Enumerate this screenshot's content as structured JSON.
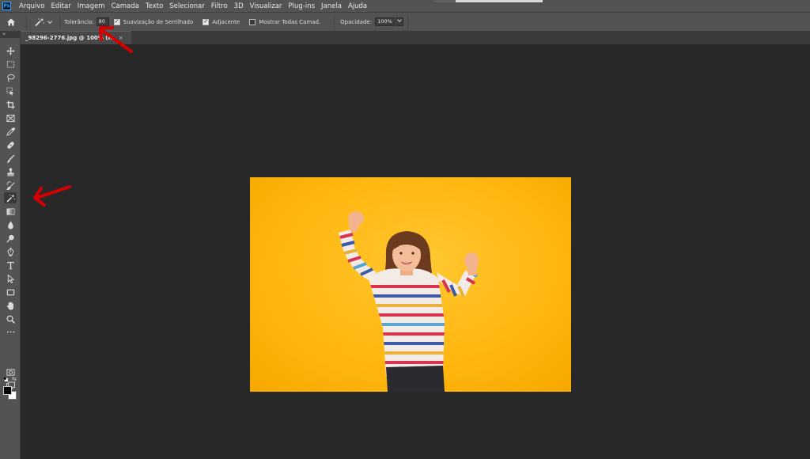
{
  "app": {
    "logo": "Ps",
    "colors": {
      "chrome": "#535353",
      "workspace": "#282828",
      "canvas_bg": "#ffb70f",
      "annotation": "#d40000"
    }
  },
  "menu": [
    "Arquivo",
    "Editar",
    "Imagem",
    "Camada",
    "Texto",
    "Selecionar",
    "Filtro",
    "3D",
    "Visualizar",
    "Plug-ins",
    "Janela",
    "Ajuda"
  ],
  "options": {
    "tool_icon": "magic-wand-icon",
    "tolerance_label": "Tolerância:",
    "tolerance_value": "80",
    "antialias_label": "Suavização de Serrilhado",
    "antialias_checked": true,
    "contiguous_label": "Adjacente",
    "contiguous_checked": true,
    "sample_all_label": "Mostrar Todas Camad.",
    "sample_all_checked": false,
    "opacity_label": "Opacidade:",
    "opacity_value": "100%"
  },
  "document": {
    "tab_title": "_98296-2776.jpg @ 100% (R",
    "close_glyph": "×"
  },
  "toolbar": {
    "collapse_glyph": "»",
    "active_tool": "magic-wand-tool"
  }
}
